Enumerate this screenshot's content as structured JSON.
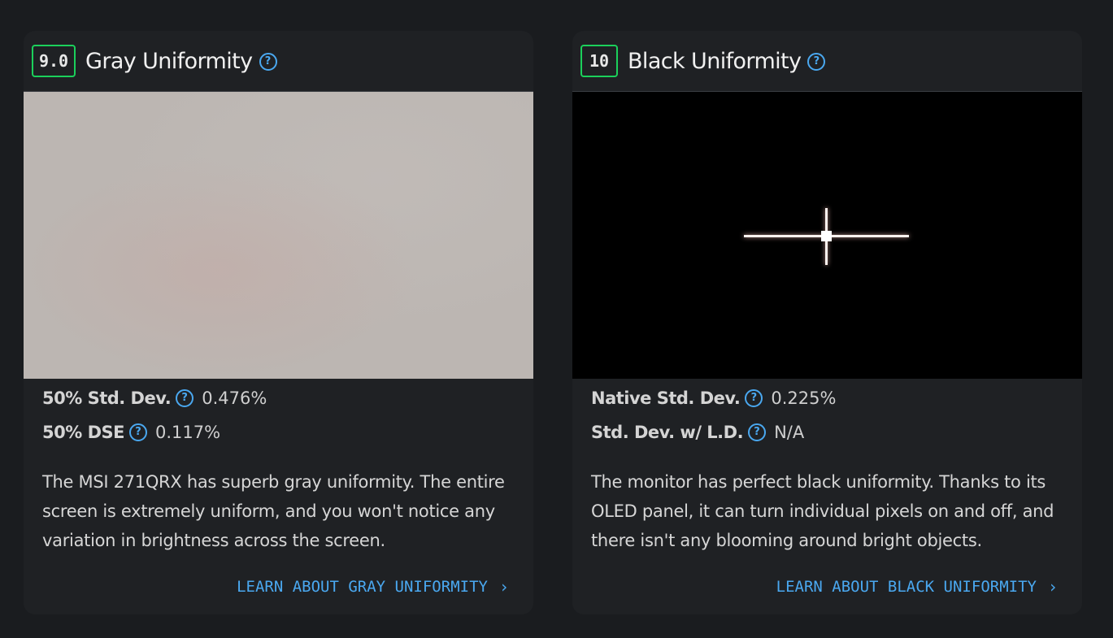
{
  "gray": {
    "score": "9.0",
    "title": "Gray Uniformity",
    "stats": [
      {
        "label": "50% Std. Dev.",
        "value": "0.476%"
      },
      {
        "label": "50% DSE",
        "value": "0.117%"
      }
    ],
    "description": "The MSI 271QRX has superb gray uniformity. The entire screen is extremely uniform, and you won't notice any variation in brightness across the screen.",
    "learn_label": "LEARN ABOUT GRAY UNIFORMITY"
  },
  "black": {
    "score": "10",
    "title": "Black Uniformity",
    "stats": [
      {
        "label": "Native Std. Dev.",
        "value": "0.225%"
      },
      {
        "label": "Std. Dev. w/ L.D.",
        "value": "N/A"
      }
    ],
    "description": "The monitor has perfect black uniformity. Thanks to its OLED panel, it can turn individual pixels on and off, and there isn't any blooming around bright objects.",
    "learn_label": "LEARN ABOUT BLACK UNIFORMITY"
  },
  "ui": {
    "help_glyph": "?",
    "chevron_glyph": "›"
  },
  "colors": {
    "score_border": "#1bd05b",
    "link": "#4aa8f0",
    "card_bg": "#1f2124",
    "page_bg": "#1a1c1f"
  }
}
